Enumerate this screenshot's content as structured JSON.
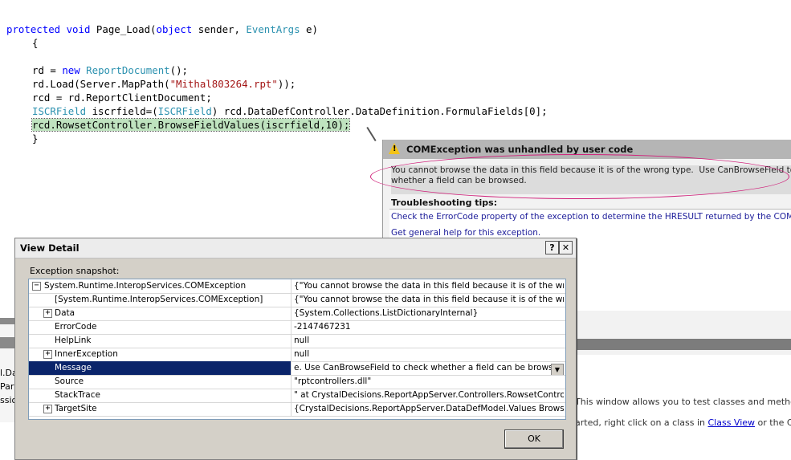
{
  "code": {
    "line1": {
      "kw": "protected void",
      "plain1": " Page_Load(",
      "kw2": "object",
      "plain2": " sender, ",
      "ty": "EventArgs",
      "plain3": " e)"
    },
    "line2": "{",
    "line3": {
      "plain1": "rd = ",
      "kw": "new",
      "plain2": " ",
      "ty": "ReportDocument",
      "plain3": "();"
    },
    "line4": {
      "plain1": "rd.Load(Server.MapPath(",
      "str": "\"Mithal803264.rpt\"",
      "plain2": "));"
    },
    "line5": "rcd = rd.ReportClientDocument;",
    "line6": {
      "ty1": "ISCRField",
      "plain1": " iscrfield=(",
      "ty2": "ISCRField",
      "plain2": ") rcd.DataDefController.DataDefinition.FormulaFields[0];"
    },
    "line7": "rcd.RowsetController.BrowseFieldValues(iscrfield,10);",
    "line8": "}"
  },
  "exception": {
    "title": "COMException was unhandled by user code",
    "message_line1": "You cannot browse the data in this field because it is of the wrong type.  Use CanBrowseField to check",
    "message_line2": "whether a field can be browsed.",
    "tips_header": "Troubleshooting tips:",
    "tips": [
      "Check the ErrorCode property of the exception to determine the HRESULT returned by the COM object.",
      "Get general help for this exception."
    ],
    "warning_icon": "warning-icon",
    "highlight_color": "#d0207a"
  },
  "background": {
    "bench_text1": "This window allows you to test classes and methods as y",
    "bench_text2_pre": "arted, right click on a class in ",
    "bench_link": "Class View",
    "bench_text2_post": " or the Class Des",
    "left_items": [
      "l.Da",
      "Para",
      "ssio"
    ]
  },
  "dialog": {
    "title": "View Detail",
    "help_label": "?",
    "close_label": "✕",
    "snapshot_label": "Exception snapshot:",
    "rows": [
      {
        "expander": "−",
        "name": "System.Runtime.InteropServices.COMException",
        "value": "{\"You cannot browse the data in this field because it is of the wrong ty"
      },
      {
        "expander": "",
        "name": "[System.Runtime.InteropServices.COMException]",
        "value": "{\"You cannot browse the data in this field because it is of the wrong ty"
      },
      {
        "expander": "+",
        "name": "Data",
        "value": "{System.Collections.ListDictionaryInternal}"
      },
      {
        "expander": "",
        "name": "ErrorCode",
        "value": "-2147467231"
      },
      {
        "expander": "",
        "name": "HelpLink",
        "value": "null"
      },
      {
        "expander": "+",
        "name": "InnerException",
        "value": "null"
      },
      {
        "expander": "",
        "name": "Message",
        "value": "e.  Use CanBrowseField to check whether a field can be browsed.\""
      },
      {
        "expander": "",
        "name": "Source",
        "value": "\"rptcontrollers.dll\""
      },
      {
        "expander": "",
        "name": "StackTrace",
        "value": "\"   at CrystalDecisions.ReportAppServer.Controllers.RowsetController"
      },
      {
        "expander": "+",
        "name": "TargetSite",
        "value": "{CrystalDecisions.ReportAppServer.DataDefModel.Values BrowseField"
      }
    ],
    "ok_label": "OK",
    "selection_color": "#0a246a"
  }
}
